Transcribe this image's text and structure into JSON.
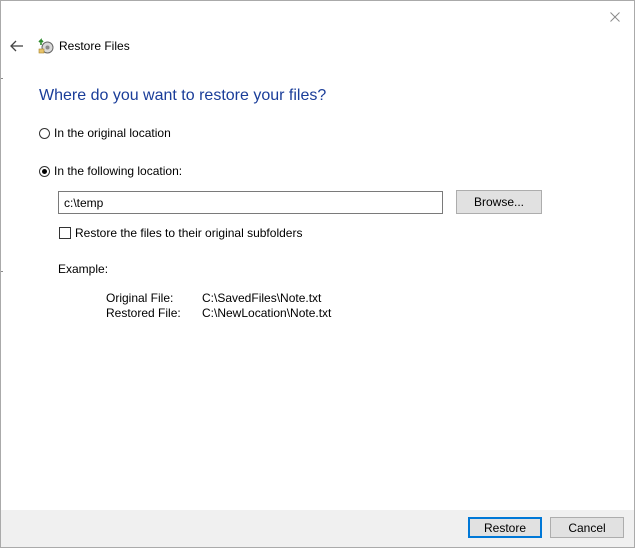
{
  "window": {
    "title": "Restore Files",
    "close_glyph": "✕",
    "back_glyph": "←"
  },
  "heading": "Where do you want to restore your files?",
  "options": {
    "original_location": {
      "label": "In the original location",
      "selected": false
    },
    "following_location": {
      "label": "In the following location:",
      "selected": true
    }
  },
  "location_input": {
    "value": "c:\\temp"
  },
  "browse_button": "Browse...",
  "subfolders_checkbox": {
    "label": "Restore the files to their original subfolders",
    "checked": false
  },
  "example": {
    "label": "Example:",
    "rows": [
      {
        "key": "Original File:",
        "value": "C:\\SavedFiles\\Note.txt"
      },
      {
        "key": "Restored File:",
        "value": "C:\\NewLocation\\Note.txt"
      }
    ]
  },
  "footer": {
    "restore_label": "Restore",
    "cancel_label": "Cancel"
  },
  "colors": {
    "heading": "#1a3d99",
    "accent_border": "#0078d7",
    "footer_bg": "#f0f0f0",
    "button_bg": "#e1e1e1"
  },
  "icons": {
    "app": "restore-files-icon",
    "back": "back-arrow-icon",
    "close": "close-icon"
  }
}
